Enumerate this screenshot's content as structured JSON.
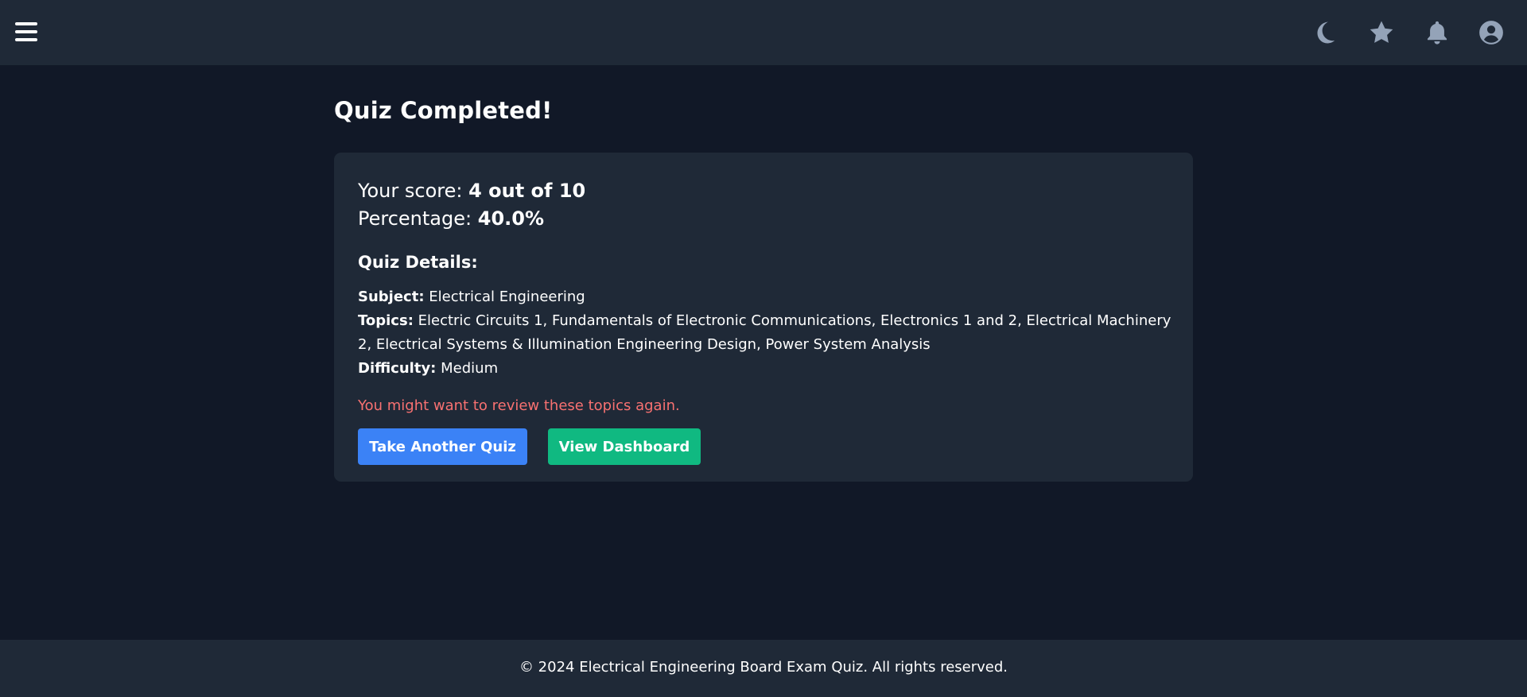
{
  "header": {
    "menu_icon": "hamburger-menu-icon",
    "icons": [
      "moon-icon",
      "star-icon",
      "bell-icon",
      "user-circle-icon"
    ]
  },
  "main": {
    "title": "Quiz Completed!",
    "score": {
      "label": "Your score:",
      "value": "4 out of 10",
      "percentage_label": "Percentage:",
      "percentage_value": "40.0%"
    },
    "details": {
      "heading": "Quiz Details:",
      "subject_label": "Subject:",
      "subject_value": "Electrical Engineering",
      "topics_label": "Topics:",
      "topics_value": "Electric Circuits 1, Fundamentals of Electronic Communications, Electronics 1 and 2, Electrical Machinery 2, Electrical Systems & Illumination Engineering Design, Power System Analysis",
      "difficulty_label": "Difficulty:",
      "difficulty_value": "Medium"
    },
    "review_message": "You might want to review these topics again.",
    "buttons": {
      "take_another": "Take Another Quiz",
      "view_dashboard": "View Dashboard"
    }
  },
  "footer": {
    "text": "© 2024 Electrical Engineering Board Exam Quiz. All rights reserved."
  },
  "colors": {
    "page_background": "#111827",
    "panel_background": "#1f2937",
    "icon_color": "#94a3b8",
    "primary_button": "#3b82f6",
    "success_button": "#10b981",
    "warning_text": "#f87171"
  }
}
